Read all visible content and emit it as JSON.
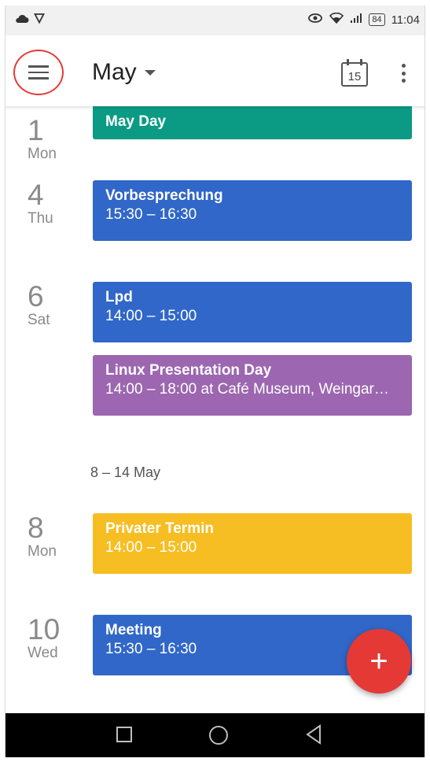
{
  "status_bar": {
    "battery": "84",
    "time": "11:04",
    "icons": [
      "cloud-icon",
      "shield-icon",
      "eye-icon",
      "wifi-icon",
      "signal-icon",
      "battery-icon"
    ]
  },
  "app_bar": {
    "month": "May",
    "today_date": "15",
    "icons": [
      "menu-icon",
      "dropdown-caret-icon",
      "calendar-today-icon",
      "more-vert-icon"
    ]
  },
  "days": [
    {
      "num": "1",
      "dow": "Mon"
    },
    {
      "num": "4",
      "dow": "Thu"
    },
    {
      "num": "6",
      "dow": "Sat"
    },
    {
      "num": "8",
      "dow": "Mon"
    },
    {
      "num": "10",
      "dow": "Wed"
    }
  ],
  "events": [
    {
      "title": "May Day",
      "detail": "",
      "color": "#0b9a84"
    },
    {
      "title": "Vorbesprechung",
      "detail": "15:30 – 16:30",
      "color": "#3067c8"
    },
    {
      "title": "Lpd",
      "detail": "14:00 – 15:00",
      "color": "#3067c8"
    },
    {
      "title": "Linux Presentation Day",
      "detail": "14:00 – 18:00 at Café Museum, Weingar…",
      "color": "#9c66b0"
    },
    {
      "title": "Privater Termin",
      "detail": "14:00 – 15:00",
      "color": "#f6be22"
    },
    {
      "title": "Meeting",
      "detail": "15:30 – 16:30",
      "color": "#3067c8"
    }
  ],
  "week_header": "8 – 14 May",
  "fab": {
    "label": "+",
    "icon": "add-icon",
    "color": "#e53935"
  },
  "nav_bar": {
    "icons": [
      "recents-square-icon",
      "home-circle-icon",
      "back-triangle-icon"
    ]
  }
}
